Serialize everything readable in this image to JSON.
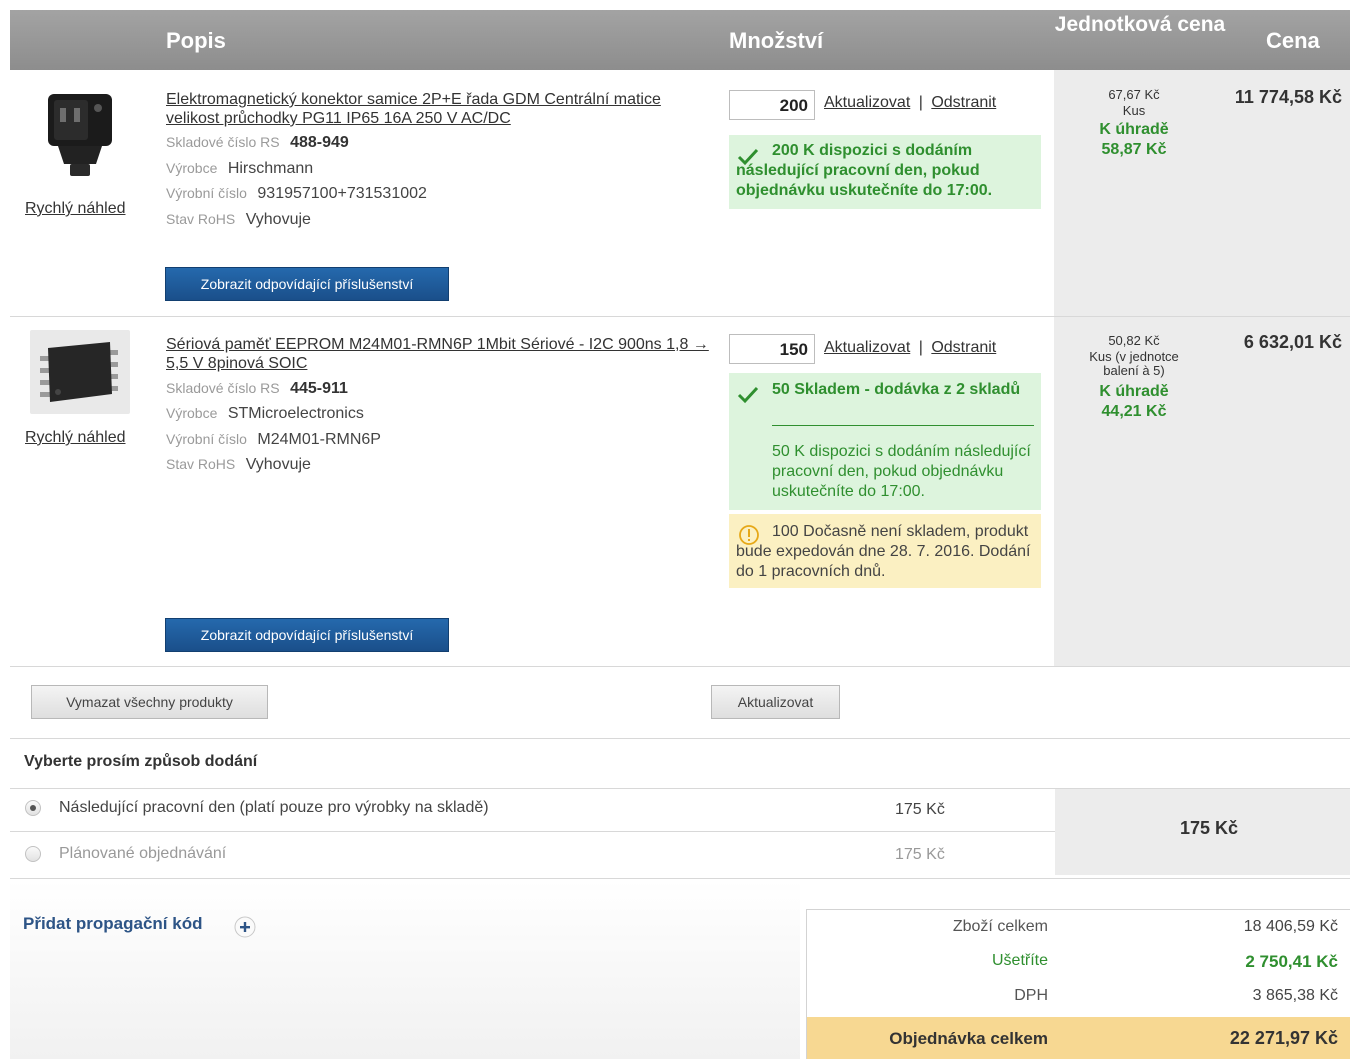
{
  "header": {
    "popis": "Popis",
    "mnozstvi": "Množství",
    "jednotkova": "Jednotková cena",
    "cena": "Cena"
  },
  "items": [
    {
      "quick_view": "Rychlý náhled",
      "title": "Elektromagnetický konektor samice 2P+E řada GDM Centrální matice velikost průchodky PG11 IP65 16A 250 V AC/DC",
      "rs_label": "Skladové číslo RS",
      "rs_value": "488-949",
      "maker_label": "Výrobce",
      "maker_value": "Hirschmann",
      "partno_label": "Výrobní číslo",
      "partno_value": "931957100+731531002",
      "rohs_label": "Stav RoHS",
      "rohs_value": "Vyhovuje",
      "accessories": "Zobrazit odpovídající příslušenství",
      "qty": "200",
      "update": "Aktualizovat",
      "separator": "|",
      "remove": "Odstranit",
      "stock_text": "200 K dispozici s dodáním následující pracovní den, pokud objednávku uskutečníte do 17:00.",
      "unit_price": "67,67 Kč",
      "unit": "Kus",
      "pay_label": "K úhradě",
      "pay_value": "58,87 Kč",
      "total": "11 774,58 Kč"
    },
    {
      "quick_view": "Rychlý náhled",
      "title": "Sériová paměť EEPROM M24M01-RMN6P 1Mbit Sériové - I2C 900ns 1,8 → 5,5 V 8pinová SOIC",
      "rs_label": "Skladové číslo RS",
      "rs_value": "445-911",
      "maker_label": "Výrobce",
      "maker_value": "STMicroelectronics",
      "partno_label": "Výrobní číslo",
      "partno_value": "M24M01-RMN6P",
      "rohs_label": "Stav RoHS",
      "rohs_value": "Vyhovuje",
      "accessories": "Zobrazit odpovídající příslušenství",
      "qty": "150",
      "update": "Aktualizovat",
      "separator": "|",
      "remove": "Odstranit",
      "stock_head": "50 Skladem - dodávka z 2 skladů",
      "stock_text": "50 K dispozici s dodáním následující pracovní den, pokud objednávku uskutečníte do 17:00.",
      "warn_text": "100 Dočasně není skladem, produkt bude expedován dne 28. 7. 2016. Dodání do 1 pracovních dnů.",
      "unit_price": "50,82 Kč",
      "unit": "Kus (v jednotce balení à 5)",
      "pay_label": "K úhradě",
      "pay_value": "44,21 Kč",
      "total": "6 632,01 Kč"
    }
  ],
  "actions": {
    "clear_all": "Vymazat všechny produkty",
    "update": "Aktualizovat"
  },
  "delivery": {
    "heading": "Vyberte prosím způsob dodání",
    "options": [
      {
        "label": "Následující pracovní den (platí pouze pro výrobky na skladě)",
        "price": "175 Kč",
        "selected": true
      },
      {
        "label": "Plánované objednávání",
        "price": "175 Kč",
        "selected": false
      }
    ],
    "selected_price": "175 Kč"
  },
  "promo": {
    "label": "Přidat propagační kód",
    "icon": "plus-circle-icon"
  },
  "summary": {
    "goods_label": "Zboží celkem",
    "goods_value": "18 406,59 Kč",
    "save_label": "Ušetříte",
    "save_value": "2 750,41 Kč",
    "vat_label": "DPH",
    "vat_value": "3 865,38 Kč",
    "total_label": "Objednávka celkem",
    "total_value": "22 271,97 Kč"
  },
  "colors": {
    "header": "#999999",
    "accent_blue": "#1f5c9c",
    "stock_green": "#2f8f2f",
    "stock_bg": "#ddf4dd",
    "warn_bg": "#fbf0c2",
    "total_bg": "#f7d892"
  }
}
